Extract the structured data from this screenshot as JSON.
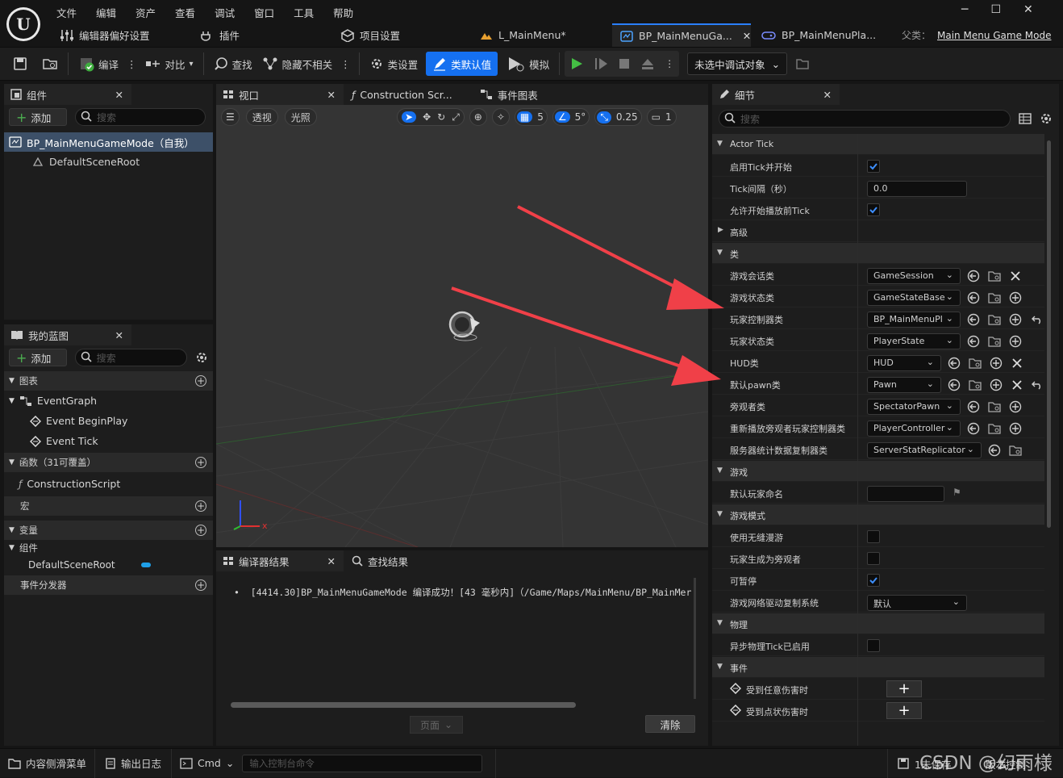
{
  "menu": [
    "文件",
    "编辑",
    "资产",
    "查看",
    "调试",
    "窗口",
    "工具",
    "帮助"
  ],
  "quicktabs": {
    "editor_prefs": "编辑器偏好设置",
    "plugins": "插件",
    "project_settings": "项目设置"
  },
  "doc_tabs": [
    {
      "label": "L_MainMenu*"
    },
    {
      "label": "BP_MainMenuGa..."
    },
    {
      "label": "BP_MainMenuPla..."
    }
  ],
  "parent_class": {
    "label": "父类：",
    "value": "Main Menu Game Mode"
  },
  "toolbar": {
    "compile": "编译",
    "diff": "对比",
    "find": "查找",
    "hide_unrelated": "隐藏不相关",
    "class_settings": "类设置",
    "class_defaults": "类默认值",
    "simulate": "模拟",
    "debug_target": "未选中调试对象"
  },
  "components": {
    "tab": "组件",
    "add": "添加",
    "search_placeholder": "搜索",
    "root": "BP_MainMenuGameMode（自我）",
    "child": "DefaultSceneRoot"
  },
  "viewport_tabs": {
    "viewport": "视口",
    "construction": "Construction Scr...",
    "event_graph": "事件图表"
  },
  "viewport": {
    "perspective": "透视",
    "lighting": "光照",
    "grid": "5",
    "angle": "5°",
    "scale": "0.25",
    "camera": "1"
  },
  "myblueprint": {
    "tab": "我的蓝图",
    "add": "添加",
    "search_placeholder": "搜索",
    "graphs": "图表",
    "eventgraph": "EventGraph",
    "begin_play": "Event BeginPlay",
    "tick": "Event Tick",
    "functions": "函数（31可覆盖）",
    "construction_script": "ConstructionScript",
    "macros": "宏",
    "variables": "变量",
    "components_group": "组件",
    "default_root": "DefaultSceneRoot",
    "dispatchers": "事件分发器"
  },
  "output": {
    "tab_compiler": "编译器结果",
    "tab_find": "查找结果",
    "message": "[4414.30]BP_MainMenuGameMode 编译成功！[43 毫秒内]（/Game/Maps/MainMenu/BP_MainMer",
    "page": "页面",
    "clear": "清除"
  },
  "details": {
    "tab": "细节",
    "search_placeholder": "搜索",
    "actor_tick": {
      "header": "Actor Tick",
      "start_enabled": "启用Tick并开始",
      "interval": "Tick间隔（秒）",
      "interval_value": "0.0",
      "before_begin": "允许开始播放前Tick",
      "advanced": "高级"
    },
    "classes": {
      "header": "类",
      "rows": [
        {
          "label": "游戏会话类",
          "value": "GameSession"
        },
        {
          "label": "游戏状态类",
          "value": "GameStateBase"
        },
        {
          "label": "玩家控制器类",
          "value": "BP_MainMenuPl"
        },
        {
          "label": "玩家状态类",
          "value": "PlayerState"
        },
        {
          "label": "HUD类",
          "value": "HUD"
        },
        {
          "label": "默认pawn类",
          "value": "Pawn"
        },
        {
          "label": "旁观者类",
          "value": "SpectatorPawn"
        },
        {
          "label": "重新播放旁观者玩家控制器类",
          "value": "PlayerController"
        },
        {
          "label": "服务器统计数据复制器类",
          "value": "ServerStatReplicator"
        }
      ]
    },
    "game": {
      "header": "游戏",
      "default_player_name": "默认玩家命名"
    },
    "game_mode": {
      "header": "游戏模式",
      "seamless_travel": "使用无缝漫游",
      "start_spectators": "玩家生成为旁观者",
      "pausable": "可暂停",
      "net_driver": "游戏网络驱动复制系统",
      "net_driver_value": "默认"
    },
    "physics": {
      "header": "物理",
      "async_tick": "异步物理Tick已启用"
    },
    "events": {
      "header": "事件",
      "any_damage": "受到任意伤害时",
      "point_damage": "受到点状伤害时"
    }
  },
  "statusbar": {
    "content_drawer": "内容侧滑菜单",
    "output_log": "输出日志",
    "cmd": "Cmd",
    "console_placeholder": "输入控制台命令",
    "unsaved": "1未保存",
    "source_control": "版本控制"
  },
  "watermark": "CSDN @幻雨様",
  "colors": {
    "accent": "#2a7fff",
    "play_green": "#44c044",
    "arrow_red": "#f04048",
    "check_blue": "#3d8fff"
  }
}
